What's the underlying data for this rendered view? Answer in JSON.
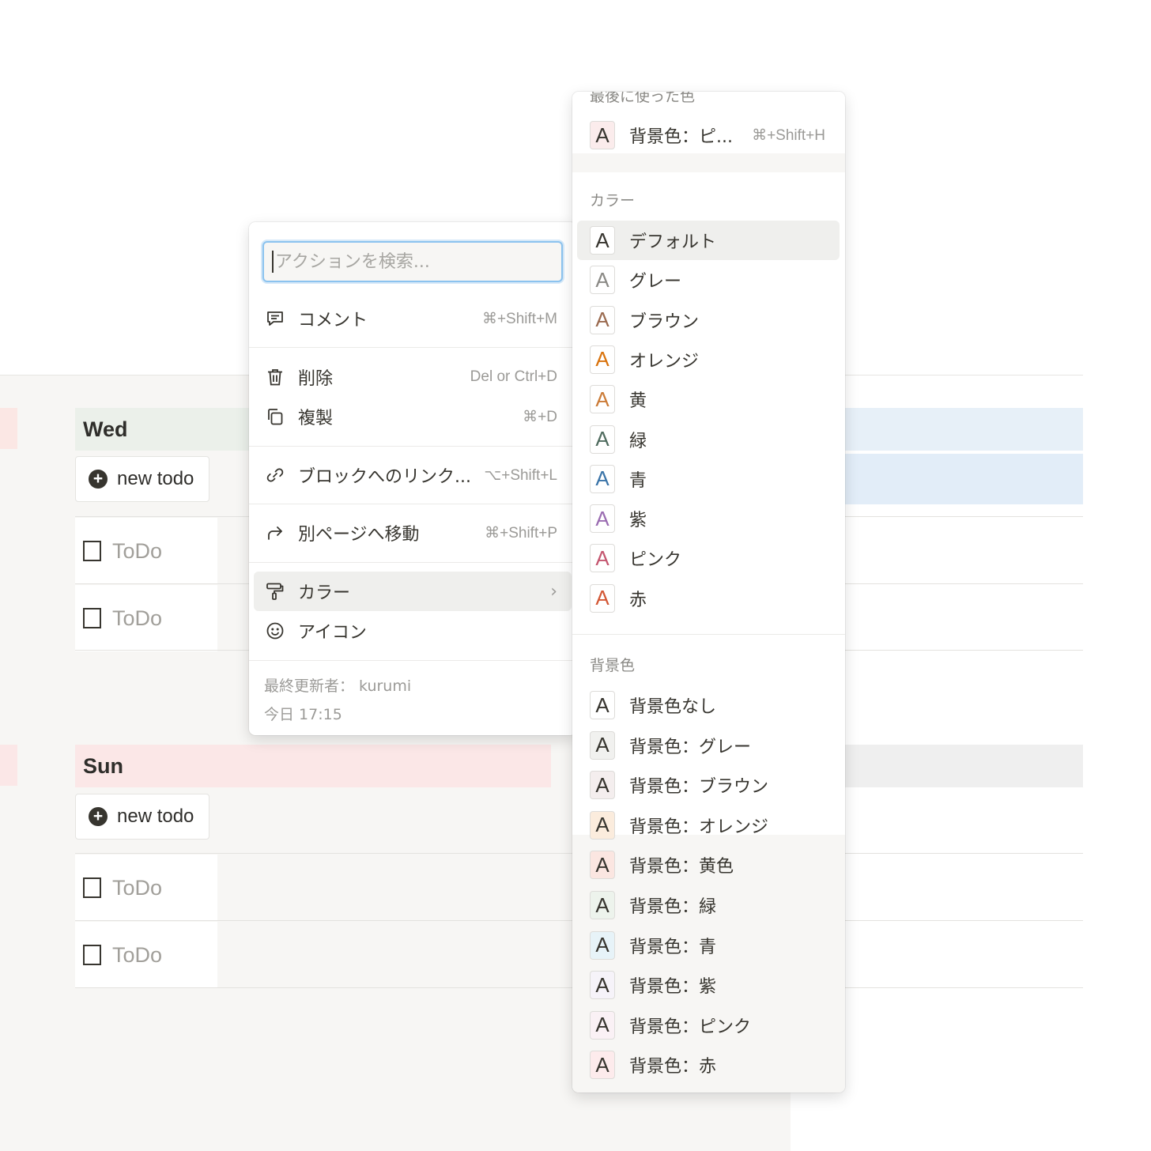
{
  "board": {
    "columns": [
      {
        "title": "Wed",
        "new_todo": "new todo",
        "cards": [
          "ToDo",
          "ToDo"
        ]
      },
      {
        "title": "Sun",
        "new_todo": "new todo",
        "cards": [
          "ToDo",
          "ToDo"
        ]
      }
    ]
  },
  "menu": {
    "search_placeholder": "アクションを検索...",
    "items": [
      {
        "label": "コメント",
        "shortcut": "⌘+Shift+M",
        "icon": "comment-icon"
      },
      {
        "label": "削除",
        "shortcut": "Del or Ctrl+D",
        "icon": "trash-icon"
      },
      {
        "label": "複製",
        "shortcut": "⌘+D",
        "icon": "duplicate-icon"
      },
      {
        "label": "ブロックへのリンク...",
        "shortcut": "⌥+Shift+L",
        "icon": "link-icon"
      },
      {
        "label": "別ページへ移動",
        "shortcut": "⌘+Shift+P",
        "icon": "move-arrow-icon"
      },
      {
        "label": "カラー",
        "shortcut": "",
        "icon": "paint-roller-icon",
        "chevron": "›"
      },
      {
        "label": "アイコン",
        "shortcut": "",
        "icon": "smiley-icon"
      }
    ],
    "last_edited_by": "最終更新者： kurumi",
    "last_edited_time": "今日 17:15"
  },
  "color_menu": {
    "recent_heading": "最後に使った色",
    "recent_item": {
      "label": "背景色：ピ...",
      "shortcut": "⌘+Shift+H",
      "text_color": "#37352f",
      "bg_color": "#fbecec"
    },
    "text_heading": "カラー",
    "text_colors": [
      {
        "label": "デフォルト",
        "color": "#37352f"
      },
      {
        "label": "グレー",
        "color": "#8a8985"
      },
      {
        "label": "ブラウン",
        "color": "#9a6a4f"
      },
      {
        "label": "オレンジ",
        "color": "#d9730d"
      },
      {
        "label": "黄",
        "color": "#cb7b37"
      },
      {
        "label": "緑",
        "color": "#4f6b5e"
      },
      {
        "label": "青",
        "color": "#3a74a8"
      },
      {
        "label": "紫",
        "color": "#9a6cb1"
      },
      {
        "label": "ピンク",
        "color": "#c4566f"
      },
      {
        "label": "赤",
        "color": "#d35735"
      }
    ],
    "bg_heading": "背景色",
    "bg_colors": [
      {
        "label": "背景色なし",
        "color": "#ffffff"
      },
      {
        "label": "背景色：グレー",
        "color": "#f1f1ef"
      },
      {
        "label": "背景色：ブラウン",
        "color": "#f4eeee"
      },
      {
        "label": "背景色：オレンジ",
        "color": "#fbecdd"
      },
      {
        "label": "背景色：黄色",
        "color": "#fbe6e1"
      },
      {
        "label": "背景色：緑",
        "color": "#edf3ec"
      },
      {
        "label": "背景色：青",
        "color": "#e7f3f8"
      },
      {
        "label": "背景色：紫",
        "color": "#f6f3f9"
      },
      {
        "label": "背景色：ピンク",
        "color": "#faf1f5"
      },
      {
        "label": "背景色：赤",
        "color": "#fdebec"
      }
    ]
  }
}
